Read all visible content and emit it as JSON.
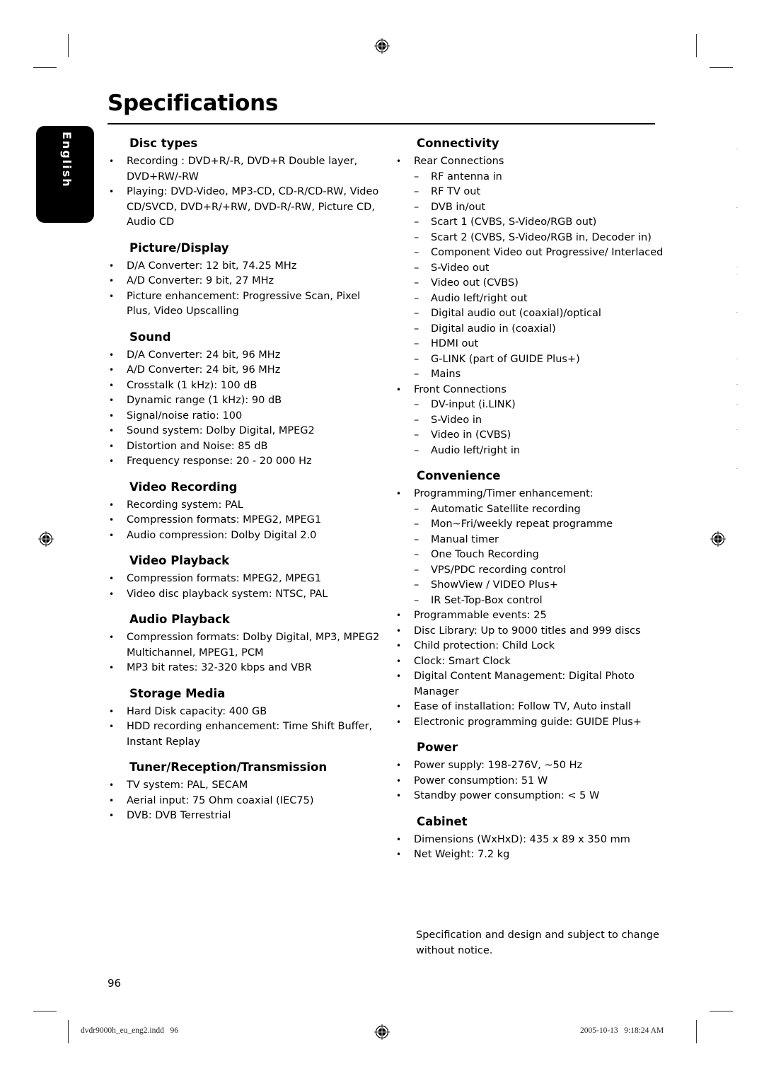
{
  "page": {
    "title": "Specifications",
    "language_tab": "English",
    "page_number": "96",
    "footer_file": "dvdr9000h_eu_eng2.indd   96",
    "footer_timestamp": "2005-10-13   9:18:24 AM",
    "note": "Specification and design and subject to change without notice."
  },
  "left_column": [
    {
      "heading": "Disc types",
      "items": [
        {
          "text": "Recording : DVD+R/-R, DVD+R Double layer, DVD+RW/-RW"
        },
        {
          "text": "Playing: DVD-Video, MP3-CD, CD-R/CD-RW, Video CD/SVCD, DVD+R/+RW, DVD-R/-RW, Picture CD, Audio CD"
        }
      ]
    },
    {
      "heading": "Picture/Display",
      "items": [
        {
          "text": "D/A Converter: 12 bit, 74.25 MHz"
        },
        {
          "text": "A/D Converter: 9 bit, 27 MHz"
        },
        {
          "text": "Picture enhancement: Progressive Scan, Pixel Plus, Video Upscalling"
        }
      ]
    },
    {
      "heading": "Sound",
      "items": [
        {
          "text": "D/A Converter: 24 bit, 96 MHz"
        },
        {
          "text": "A/D Converter: 24 bit, 96 MHz"
        },
        {
          "text": "Crosstalk (1 kHz): 100 dB"
        },
        {
          "text": "Dynamic range (1 kHz): 90 dB"
        },
        {
          "text": "Signal/noise ratio: 100"
        },
        {
          "text": "Sound system: Dolby Digital, MPEG2"
        },
        {
          "text": "Distortion and Noise: 85 dB"
        },
        {
          "text": "Frequency response: 20 - 20 000 Hz"
        }
      ]
    },
    {
      "heading": "Video Recording",
      "items": [
        {
          "text": "Recording system: PAL"
        },
        {
          "text": "Compression formats: MPEG2, MPEG1"
        },
        {
          "text": "Audio compression: Dolby Digital 2.0"
        }
      ]
    },
    {
      "heading": "Video Playback",
      "items": [
        {
          "text": "Compression formats: MPEG2, MPEG1"
        },
        {
          "text": "Video disc playback system: NTSC, PAL"
        }
      ]
    },
    {
      "heading": "Audio Playback",
      "items": [
        {
          "text": "Compression formats: Dolby Digital, MP3, MPEG2 Multichannel, MPEG1, PCM"
        },
        {
          "text": "MP3 bit rates: 32-320 kbps and VBR"
        }
      ]
    },
    {
      "heading": "Storage Media",
      "items": [
        {
          "text": "Hard Disk capacity: 400 GB"
        },
        {
          "text": "HDD recording enhancement: Time Shift Buffer, Instant Replay"
        }
      ]
    },
    {
      "heading": "Tuner/Reception/Transmission",
      "items": [
        {
          "text": "TV system: PAL, SECAM"
        },
        {
          "text": "Aerial input: 75 Ohm coaxial (IEC75)"
        },
        {
          "text": "DVB: DVB Terrestrial"
        }
      ]
    }
  ],
  "right_column": [
    {
      "heading": "Connectivity",
      "items": [
        {
          "text": "Rear Connections",
          "sub": [
            "RF antenna in",
            "RF TV out",
            "DVB in/out",
            "Scart 1 (CVBS, S-Video/RGB out)",
            "Scart 2 (CVBS, S-Video/RGB in, Decoder in)",
            "Component Video out Progressive/ Interlaced",
            "S-Video out",
            "Video out (CVBS)",
            "Audio left/right out",
            "Digital audio out (coaxial)/optical",
            "Digital audio in (coaxial)",
            "HDMI out",
            "G-LINK (part of GUIDE Plus+)",
            "Mains"
          ]
        },
        {
          "text": "Front Connections",
          "sub": [
            "DV-input (i.LINK)",
            "S-Video in",
            "Video in (CVBS)",
            "Audio left/right in"
          ]
        }
      ]
    },
    {
      "heading": "Convenience",
      "items": [
        {
          "text": "Programming/Timer enhancement:",
          "sub": [
            "Automatic Satellite recording",
            "Mon~Fri/weekly repeat programme",
            "Manual timer",
            "One Touch Recording",
            "VPS/PDC recording control",
            "ShowView / VIDEO Plus+",
            "IR Set-Top-Box control"
          ]
        },
        {
          "text": "Programmable events: 25"
        },
        {
          "text": "Disc Library: Up to 9000 titles and 999 discs"
        },
        {
          "text": "Child protection: Child Lock"
        },
        {
          "text": "Clock: Smart Clock"
        },
        {
          "text": "Digital Content Management: Digital Photo Manager"
        },
        {
          "text": "Ease of installation: Follow TV, Auto install"
        },
        {
          "text": "Electronic programming guide: GUIDE Plus+"
        }
      ]
    },
    {
      "heading": "Power",
      "items": [
        {
          "text": "Power supply: 198-276V, ~50 Hz"
        },
        {
          "text": "Power consumption: 51 W"
        },
        {
          "text": "Standby power consumption: < 5 W"
        }
      ]
    },
    {
      "heading": "Cabinet",
      "items": [
        {
          "text": "Dimensions (WxHxD): 435 x 89 x 350 mm"
        },
        {
          "text": "Net Weight: 7.2 kg"
        }
      ]
    }
  ],
  "symbols": {
    "bullet": "•",
    "dash": "–"
  }
}
